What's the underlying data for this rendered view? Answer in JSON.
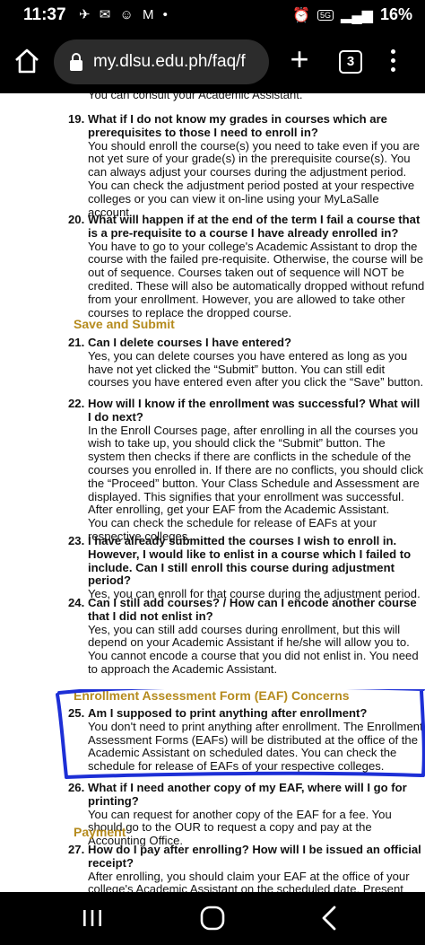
{
  "status_bar": {
    "time": "11:37",
    "left_icons": "✈ ✉ ☺ M •",
    "sg": "5G",
    "battery": "16%"
  },
  "browser": {
    "url": "my.dlsu.edu.ph/faq/f",
    "tab_count": "3"
  },
  "content": {
    "cut_off_line": "You can consult your Academic Assistant.",
    "faqs": [
      {
        "num": "19.",
        "question": "What if I do not know my grades in courses which are prerequisites to those I need to enroll in?",
        "answer": "You should enroll the course(s) you need to take even if you are not yet sure of your grade(s) in the prerequisite course(s). You can always adjust your courses during the adjustment period. You can check the adjustment period posted at your respective colleges or you can view it on-line using your MyLaSalle account."
      },
      {
        "num": "20.",
        "question": "What will happen if at the end of the term I fail a course that is a pre-requisite to a course I have already enrolled in?",
        "answer": "You have to go to your college's Academic Assistant to drop the course with the failed pre-requisite. Otherwise, the course will be out of sequence. Courses taken out of sequence will NOT be credited. These will also be automatically dropped without refund from your enrollment. However, you are allowed to take other courses to replace the dropped course."
      },
      {
        "num": "21.",
        "question": "Can I delete courses I have entered?",
        "answer": "Yes, you can delete courses you have entered as long as you have not yet clicked the “Submit” button. You can still edit courses you have entered even after you click the “Save” button."
      },
      {
        "num": "22.",
        "question": "How will I know if the enrollment was successful? What will I do next?",
        "answer": "In the Enroll Courses page, after enrolling in all the courses you wish to take up, you should click the “Submit” button. The system then checks if there are conflicts in the schedule of the courses you enrolled in. If there are no conflicts, you should click the “Proceed” button. Your Class Schedule and Assessment are displayed. This signifies that your enrollment was successful. After enrolling, get your EAF from the Academic Assistant.",
        "answer2": "You can check the schedule for release of EAFs at your respective colleges."
      },
      {
        "num": "23.",
        "question": "I have already submitted the courses I wish to enroll in. However, I would like to enlist in a course which I failed to include. Can I still enroll this course during adjustment period?",
        "answer": "Yes, you can enroll for that course during the adjustment period."
      },
      {
        "num": "24.",
        "question": "Can I still add courses? / How can I encode another course that I did not enlist in?",
        "answer": "Yes, you can still add courses during enrollment, but this will depend on your Academic Assistant if he/she will allow you to. You cannot encode a course that you did not enlist in. You need to approach the Academic Assistant."
      },
      {
        "num": "25.",
        "question": "Am I supposed to print anything after enrollment?",
        "answer": "You don't need to print anything after enrollment. The Enrollment Assessment Forms (EAFs) will be distributed at the office of the Academic Assistant on scheduled dates. You can check the schedule for release of EAFs of your respective colleges."
      },
      {
        "num": "26.",
        "question": "What if I need another copy of my EAF, where will I go for printing?",
        "answer": "You can request for another copy of the EAF for a fee. You should go to the OUR to request a copy and pay at the Accounting Office."
      },
      {
        "num": "27.",
        "question": "How do I pay after enrolling? How will I be issued an official receipt?",
        "answer": "After enrolling, you should claim your EAF at the office of your college's Academic Assistant on the scheduled date. Present your EAF at the Accounting Office and pay the tuition fees. The Accounting Office will"
      }
    ],
    "sections": {
      "save_submit": "Save and Submit",
      "eaf_concerns": "Enrollment Assessment Form (EAF) Concerns",
      "payment": "Payment"
    }
  },
  "colors": {
    "section_heading": "#b58b1e",
    "highlight_stroke": "#1d2fd6"
  }
}
